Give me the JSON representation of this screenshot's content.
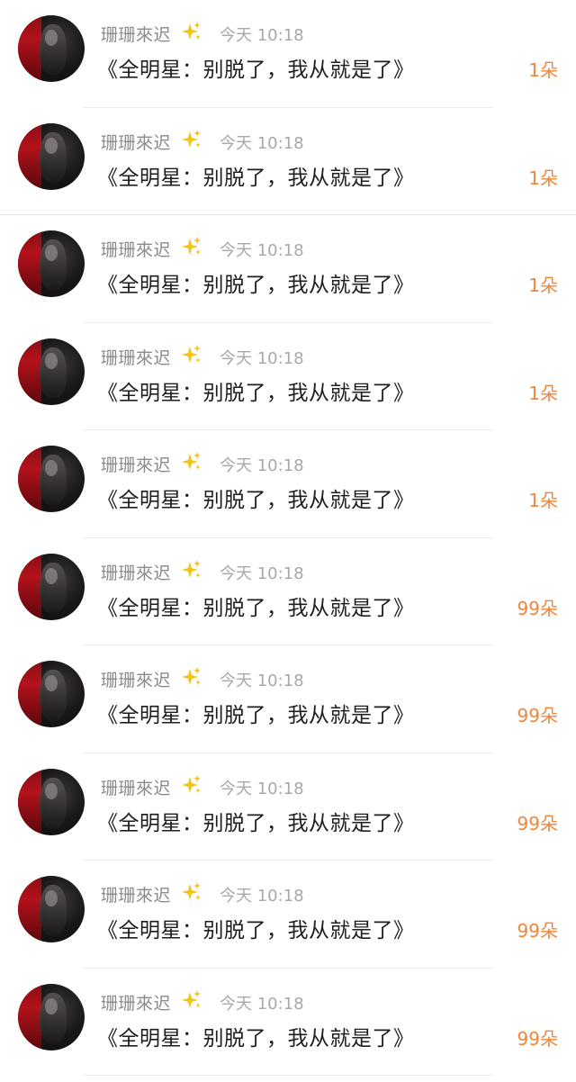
{
  "items": [
    {
      "user": "珊珊來迟",
      "time": "今天 10:18",
      "message": "《全明星：别脱了，我从就是了》",
      "count": "1朵"
    },
    {
      "user": "珊珊來迟",
      "time": "今天 10:18",
      "message": "《全明星：别脱了，我从就是了》",
      "count": "1朵"
    },
    {
      "user": "珊珊來迟",
      "time": "今天 10:18",
      "message": "《全明星：别脱了，我从就是了》",
      "count": "1朵"
    },
    {
      "user": "珊珊來迟",
      "time": "今天 10:18",
      "message": "《全明星：别脱了，我从就是了》",
      "count": "1朵"
    },
    {
      "user": "珊珊來迟",
      "time": "今天 10:18",
      "message": "《全明星：别脱了，我从就是了》",
      "count": "1朵"
    },
    {
      "user": "珊珊來迟",
      "time": "今天 10:18",
      "message": "《全明星：别脱了，我从就是了》",
      "count": "99朵"
    },
    {
      "user": "珊珊來迟",
      "time": "今天 10:18",
      "message": "《全明星：别脱了，我从就是了》",
      "count": "99朵"
    },
    {
      "user": "珊珊來迟",
      "time": "今天 10:18",
      "message": "《全明星：别脱了，我从就是了》",
      "count": "99朵"
    },
    {
      "user": "珊珊來迟",
      "time": "今天 10:18",
      "message": "《全明星：别脱了，我从就是了》",
      "count": "99朵"
    },
    {
      "user": "珊珊來迟",
      "time": "今天 10:18",
      "message": "《全明星：别脱了，我从就是了》",
      "count": "99朵"
    }
  ],
  "icons": {
    "badge": "sparkle-icon",
    "avatar": "avatar-image"
  },
  "colors": {
    "count": "#f0863a",
    "sparkle": "#f2c418",
    "username": "#8a8a8a",
    "time": "#a8a8a8"
  }
}
